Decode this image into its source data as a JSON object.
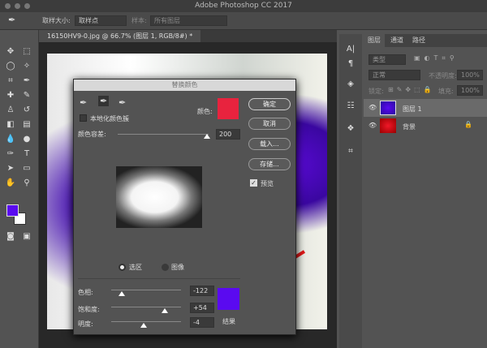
{
  "app": {
    "title": "Adobe Photoshop CC 2017"
  },
  "options": {
    "sample_size_label": "取样大小:",
    "sample_size_value": "取样点",
    "sample_label": "样本:",
    "sample_value": "所有图层"
  },
  "document": {
    "tab": "16150HV9-0.jpg @ 66.7% (图层 1, RGB/8#) *"
  },
  "dialog": {
    "title": "替换颜色",
    "localized_clusters": "本地化颜色簇",
    "color_label": "颜色:",
    "color": "#e8233e",
    "tolerance_label": "颜色容差:",
    "tolerance": "200",
    "tolerance_fraction": 0.95,
    "buttons": {
      "ok": "确定",
      "cancel": "取消",
      "load": "载入...",
      "save": "存储..."
    },
    "preview": "预览",
    "preview_checked": true,
    "radio_selection": "选区",
    "radio_image": "图像",
    "selected_radio": "选区",
    "hue_label": "色相:",
    "hue": "-122",
    "saturation_label": "饱和度:",
    "saturation": "+54",
    "lightness_label": "明度:",
    "lightness": "-4",
    "result_label": "结果",
    "result_color": "#5a0af0"
  },
  "layers_panel": {
    "tabs": [
      "图层",
      "通道",
      "路径"
    ],
    "filter": "类型",
    "blend": "正常",
    "opacity_label": "不透明度:",
    "opacity": "100%",
    "lock_label": "锁定:",
    "fill_label": "填充:",
    "fill": "100%",
    "layers": [
      {
        "name": "图层 1",
        "selected": true
      },
      {
        "name": "背景",
        "locked": true
      }
    ]
  },
  "foreground_color": "#5a0af0"
}
